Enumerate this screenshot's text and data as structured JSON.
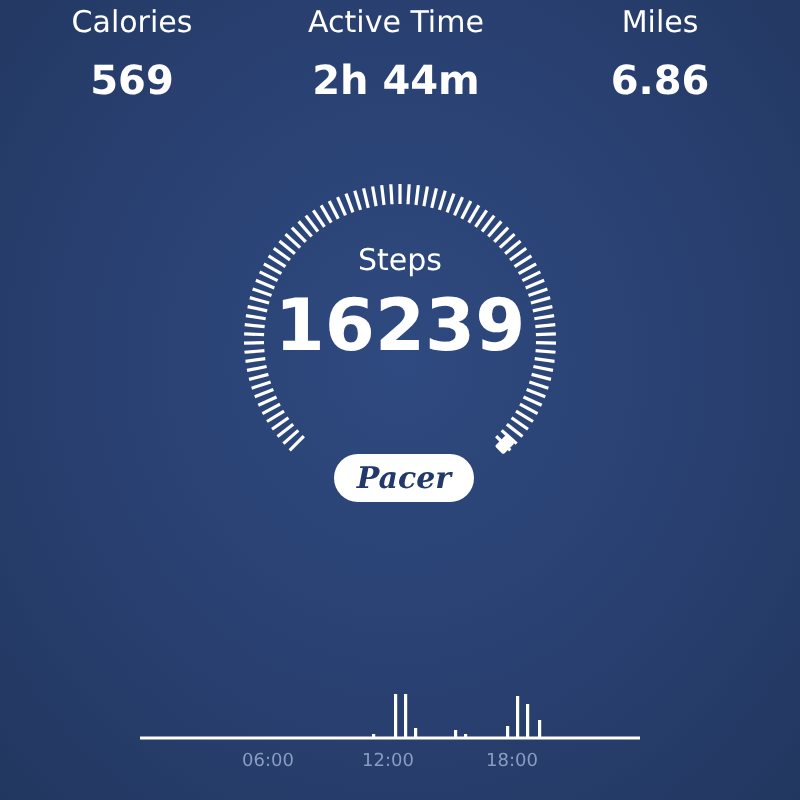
{
  "stats": [
    {
      "label": "Calories",
      "value": "569"
    },
    {
      "label": "Active Time",
      "value": "2h 44m"
    },
    {
      "label": "Miles",
      "value": "6.86"
    }
  ],
  "gauge": {
    "label": "Steps",
    "value": "16239"
  },
  "brand": "Pacer",
  "activity": {
    "axis_labels": [
      "06:00",
      "12:00",
      "18:00"
    ]
  }
}
